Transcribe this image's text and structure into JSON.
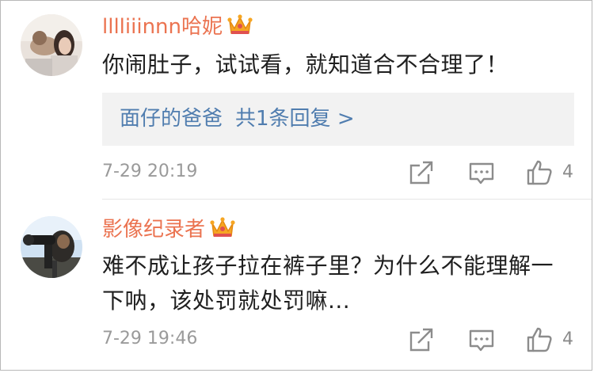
{
  "comments": [
    {
      "username": "lllliiinnn哈妮",
      "badge": "crown-icon",
      "text": "你闹肚子，试试看，就知道合不合理了！",
      "reply": {
        "author": "面仔的爸爸",
        "summary": "共1条回复 >"
      },
      "time": "7-29 20:19",
      "like_count": "4"
    },
    {
      "username": "影像纪录者",
      "badge": "crown-icon",
      "text": "难不成让孩子拉在裤子里？为什么不能理解一下呐，该处罚就处罚嘛...",
      "time": "7-29 19:46",
      "like_count": "4"
    }
  ],
  "icons": {
    "share": "share-icon",
    "comment": "comment-icon",
    "like": "like-icon"
  },
  "colors": {
    "username": "#eb7350",
    "reply_link": "#507daf",
    "meta_gray": "#9a9a9a",
    "reply_bg": "#f2f2f2",
    "crown": "#f6a623"
  }
}
